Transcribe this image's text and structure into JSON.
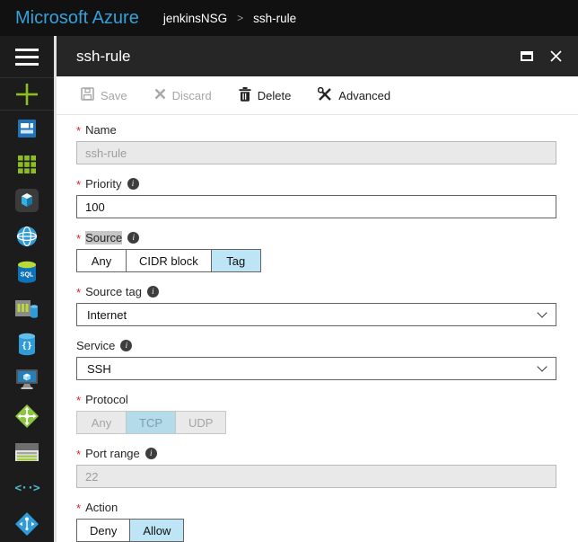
{
  "topbar": {
    "brand": "Microsoft Azure",
    "breadcrumb_items": [
      "jenkinsNSG",
      "ssh-rule"
    ],
    "separator": ">"
  },
  "blade": {
    "title": "ssh-rule"
  },
  "toolbar": {
    "items": [
      {
        "label": "Save",
        "icon": "save-icon",
        "enabled": false
      },
      {
        "label": "Discard",
        "icon": "discard-icon",
        "enabled": false
      },
      {
        "label": "Delete",
        "icon": "delete-icon",
        "enabled": true
      },
      {
        "label": "Advanced",
        "icon": "advanced-icon",
        "enabled": true
      }
    ]
  },
  "form": {
    "required_marker": "*",
    "name": {
      "label": "Name",
      "required": true,
      "value": "ssh-rule",
      "disabled": true
    },
    "priority": {
      "label": "Priority",
      "required": true,
      "has_info": true,
      "value": "100"
    },
    "source": {
      "label": "Source",
      "required": true,
      "has_info": true,
      "label_highlighted": true,
      "options": [
        "Any",
        "CIDR block",
        "Tag"
      ],
      "selected": "Tag"
    },
    "source_tag": {
      "label": "Source tag",
      "required": true,
      "has_info": true,
      "selected_value": "Internet"
    },
    "service": {
      "label": "Service",
      "required": false,
      "has_info": true,
      "selected_value": "SSH"
    },
    "protocol": {
      "label": "Protocol",
      "required": true,
      "disabled": true,
      "options": [
        "Any",
        "TCP",
        "UDP"
      ],
      "selected": "TCP"
    },
    "port_range": {
      "label": "Port range",
      "required": true,
      "has_info": true,
      "value": "22",
      "disabled": true
    },
    "action": {
      "label": "Action",
      "required": true,
      "options": [
        "Deny",
        "Allow"
      ],
      "selected": "Allow"
    }
  },
  "sidebar": {
    "items": [
      {
        "name": "hamburger-menu"
      },
      {
        "name": "new-resource"
      },
      {
        "name": "dashboard"
      },
      {
        "name": "all-resources"
      },
      {
        "name": "resource-groups"
      },
      {
        "name": "app-services"
      },
      {
        "name": "sql-databases",
        "icon_text": "SQL"
      },
      {
        "name": "sql-data-warehouse"
      },
      {
        "name": "cosmos-db",
        "icon_text": "{}"
      },
      {
        "name": "virtual-machines"
      },
      {
        "name": "load-balancers"
      },
      {
        "name": "storage-accounts"
      },
      {
        "name": "function-apps",
        "icon_text": "<··>"
      },
      {
        "name": "virtual-networks"
      }
    ]
  },
  "colors": {
    "brand_blue": "#35a0da",
    "selected_blue": "#bde5f5",
    "disabled_selected_blue": "#b4dbe9",
    "required_red": "#e02020",
    "azure_green": "#8cbe23",
    "azure_blue": "#2272b9",
    "teal": "#4db8c4"
  }
}
